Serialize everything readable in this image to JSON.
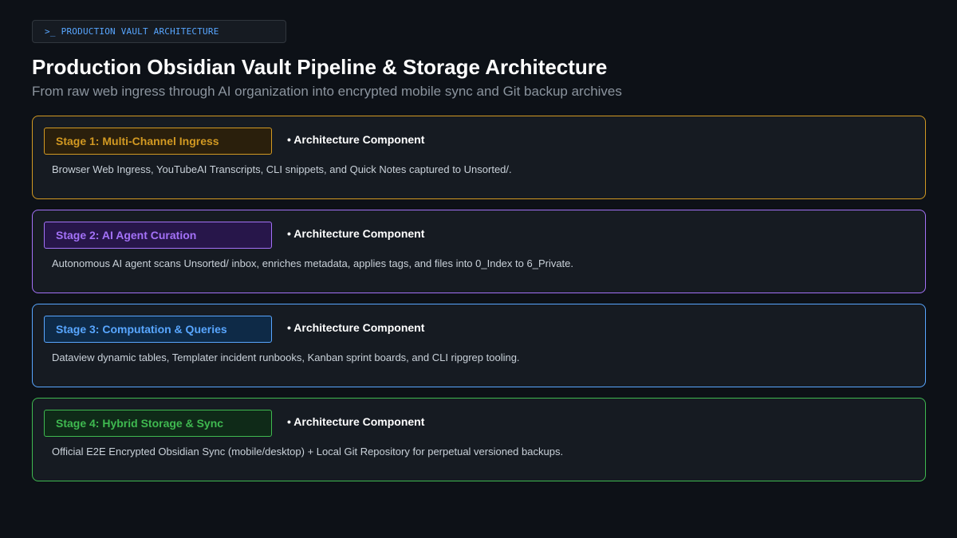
{
  "header": {
    "prompt": ">_",
    "tag": "PRODUCTION VAULT ARCHITECTURE",
    "title": "Production Obsidian Vault Pipeline & Storage Architecture",
    "subtitle": "From raw web ingress through AI organization into encrypted mobile sync and Git backup archives"
  },
  "stages": [
    {
      "label": "Stage 1: Multi-Channel Ingress",
      "component": "• Architecture Component",
      "description": "Browser Web Ingress, YouTubeAI Transcripts, CLI snippets, and Quick Notes captured to Unsorted/.",
      "color": "#d29922",
      "badge_bg": "#2a1f0c"
    },
    {
      "label": "Stage 2: AI Agent Curation",
      "component": "• Architecture Component",
      "description": "Autonomous AI agent scans Unsorted/ inbox, enriches metadata, applies tags, and files into 0_Index to 6_Private.",
      "color": "#a371f7",
      "badge_bg": "#27164a"
    },
    {
      "label": "Stage 3: Computation & Queries",
      "component": "• Architecture Component",
      "description": "Dataview dynamic tables, Templater incident runbooks, Kanban sprint boards, and CLI ripgrep tooling.",
      "color": "#58a6ff",
      "badge_bg": "#0e2a47"
    },
    {
      "label": "Stage 4: Hybrid Storage & Sync",
      "component": "• Architecture Component",
      "description": "Official E2E Encrypted Obsidian Sync (mobile/desktop) + Local Git Repository for perpetual versioned backups.",
      "color": "#3fb950",
      "badge_bg": "#0f2a18"
    }
  ]
}
